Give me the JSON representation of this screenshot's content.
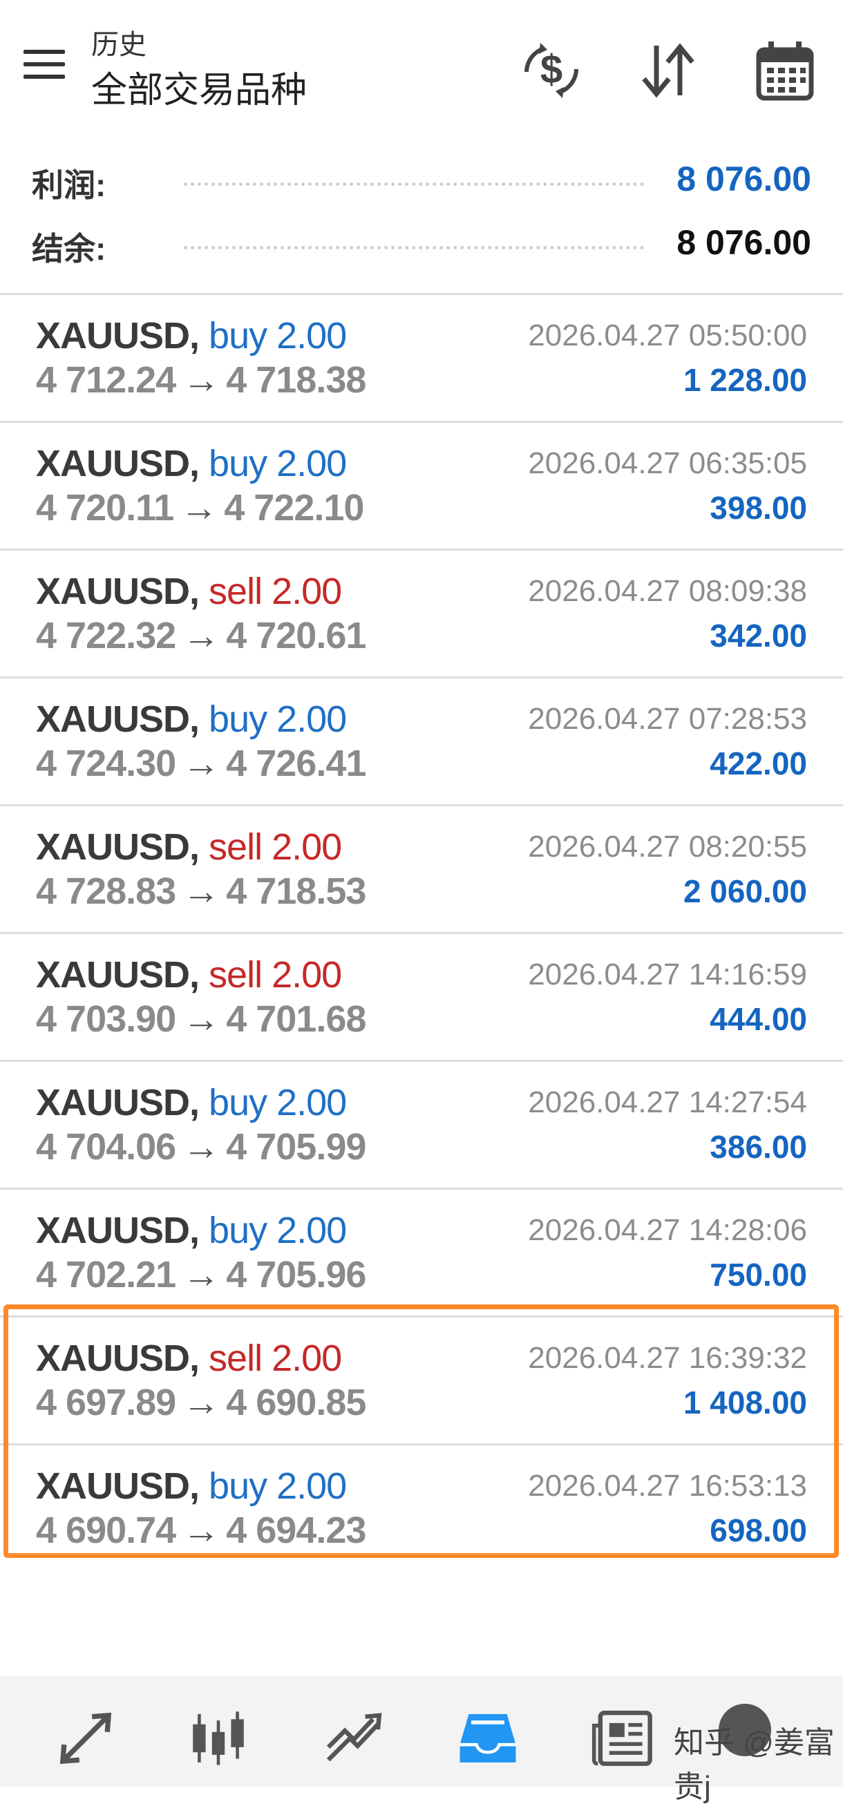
{
  "header": {
    "subtitle": "历史",
    "title": "全部交易品种",
    "icons": [
      "menu-icon",
      "dollar-exchange-icon",
      "sort-icon",
      "calendar-icon"
    ]
  },
  "summary": {
    "profit_label": "利润:",
    "profit_value": "8 076.00",
    "balance_label": "结余:",
    "balance_value": "8 076.00",
    "profit_color": "#1565c0"
  },
  "trades": [
    {
      "symbol": "XAUUSD,",
      "dir": "buy 2.00",
      "type": "buy",
      "open": "4 712.24",
      "close": "4 718.38",
      "time": "2026.04.27 05:50:00",
      "profit": "1 228.00"
    },
    {
      "symbol": "XAUUSD,",
      "dir": "buy 2.00",
      "type": "buy",
      "open": "4 720.11",
      "close": "4 722.10",
      "time": "2026.04.27 06:35:05",
      "profit": "398.00"
    },
    {
      "symbol": "XAUUSD,",
      "dir": "sell 2.00",
      "type": "sell",
      "open": "4 722.32",
      "close": "4 720.61",
      "time": "2026.04.27 08:09:38",
      "profit": "342.00"
    },
    {
      "symbol": "XAUUSD,",
      "dir": "buy 2.00",
      "type": "buy",
      "open": "4 724.30",
      "close": "4 726.41",
      "time": "2026.04.27 07:28:53",
      "profit": "422.00"
    },
    {
      "symbol": "XAUUSD,",
      "dir": "sell 2.00",
      "type": "sell",
      "open": "4 728.83",
      "close": "4 718.53",
      "time": "2026.04.27 08:20:55",
      "profit": "2 060.00"
    },
    {
      "symbol": "XAUUSD,",
      "dir": "sell 2.00",
      "type": "sell",
      "open": "4 703.90",
      "close": "4 701.68",
      "time": "2026.04.27 14:16:59",
      "profit": "444.00"
    },
    {
      "symbol": "XAUUSD,",
      "dir": "buy 2.00",
      "type": "buy",
      "open": "4 704.06",
      "close": "4 705.99",
      "time": "2026.04.27 14:27:54",
      "profit": "386.00"
    },
    {
      "symbol": "XAUUSD,",
      "dir": "buy 2.00",
      "type": "buy",
      "open": "4 702.21",
      "close": "4 705.96",
      "time": "2026.04.27 14:28:06",
      "profit": "750.00"
    },
    {
      "symbol": "XAUUSD,",
      "dir": "sell 2.00",
      "type": "sell",
      "open": "4 697.89",
      "close": "4 690.85",
      "time": "2026.04.27 16:39:32",
      "profit": "1 408.00"
    },
    {
      "symbol": "XAUUSD,",
      "dir": "buy 2.00",
      "type": "buy",
      "open": "4 690.74",
      "close": "4 694.23",
      "time": "2026.04.27 16:53:13",
      "profit": "698.00"
    }
  ],
  "arrow_glyph": "→",
  "colors": {
    "buy": "#1f6fc4",
    "sell": "#c62828",
    "highlight": "#ff8a2b",
    "active_nav": "#2196f3"
  },
  "bottom_nav": {
    "items": [
      "quotes-icon",
      "chart-icon",
      "trade-icon",
      "history-icon",
      "news-icon"
    ],
    "active": "history-icon"
  },
  "watermark": "知乎 @姜富贵j"
}
